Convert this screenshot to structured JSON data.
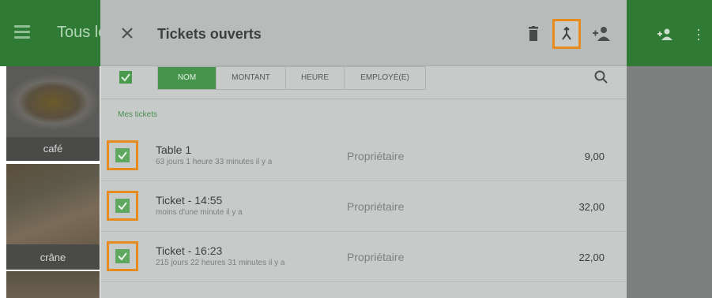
{
  "background": {
    "title": "Tous le",
    "tiles": [
      {
        "label": "café"
      },
      {
        "label": "crâne"
      },
      {
        "label": ""
      }
    ]
  },
  "header": {
    "title": "Tickets ouverts"
  },
  "toolbar": {
    "sort_tabs": [
      {
        "label": "NOM",
        "active": true
      },
      {
        "label": "MONTANT",
        "active": false
      },
      {
        "label": "HEURE",
        "active": false
      },
      {
        "label": "EMPLOYÉ(E)",
        "active": false
      }
    ]
  },
  "section": {
    "label": "Mes tickets"
  },
  "tickets": [
    {
      "name": "Table 1",
      "age": "63 jours 1 heure 33 minutes  il y a",
      "owner": "Propriétaire",
      "amount": "9,00",
      "checked": true
    },
    {
      "name": "Ticket - 14:55",
      "age": "moins d'une minute il y a",
      "owner": "Propriétaire",
      "amount": "32,00",
      "checked": true
    },
    {
      "name": "Ticket - 16:23",
      "age": "215 jours 22 heures 31 minutes  il y a",
      "owner": "Propriétaire",
      "amount": "22,00",
      "checked": true
    }
  ],
  "colors": {
    "brand_green": "#2f7a35",
    "highlight_orange": "#e68b1e",
    "check_green": "#5ea860"
  },
  "icons": {
    "close": "close-icon",
    "trash": "trash-icon",
    "merge": "merge-icon",
    "assign": "add-person-icon",
    "search": "search-icon",
    "menu": "hamburger-menu-icon"
  }
}
